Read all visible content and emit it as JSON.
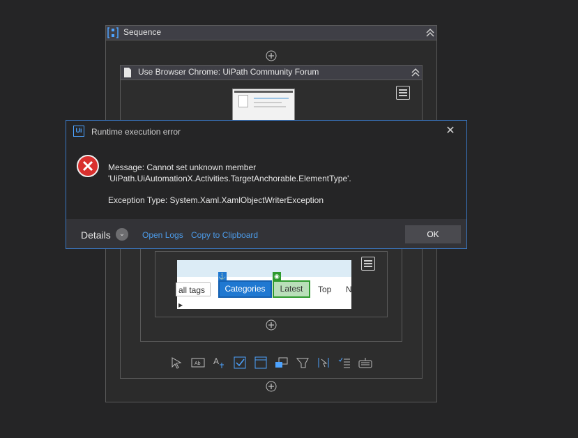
{
  "sequence": {
    "title": "Sequence"
  },
  "use_browser": {
    "title": "Use Browser Chrome: UiPath Community Forum"
  },
  "screenshot": {
    "all_tags": "all tags",
    "categories": "Categories",
    "latest": "Latest",
    "top": "Top",
    "n": "N"
  },
  "toolbar_icons": [
    "click-icon",
    "type-into-icon",
    "get-text-icon",
    "check-icon",
    "select-item-icon",
    "hover-icon",
    "highlight-icon",
    "find-element-icon",
    "extract-data-icon",
    "keyboard-icon"
  ],
  "dialog": {
    "title": "Runtime execution error",
    "message_line1": "Message: Cannot set unknown member",
    "message_line2": "'UiPath.UiAutomationX.Activities.TargetAnchorable.ElementType'.",
    "exception": "Exception Type: System.Xaml.XamlObjectWriterException",
    "details_label": "Details",
    "open_logs": "Open Logs",
    "copy_clipboard": "Copy to Clipboard",
    "ok_label": "OK",
    "logo": "Ui"
  },
  "colors": {
    "accent": "#3a78c4",
    "link": "#4c9be8",
    "error": "#d9302e"
  }
}
